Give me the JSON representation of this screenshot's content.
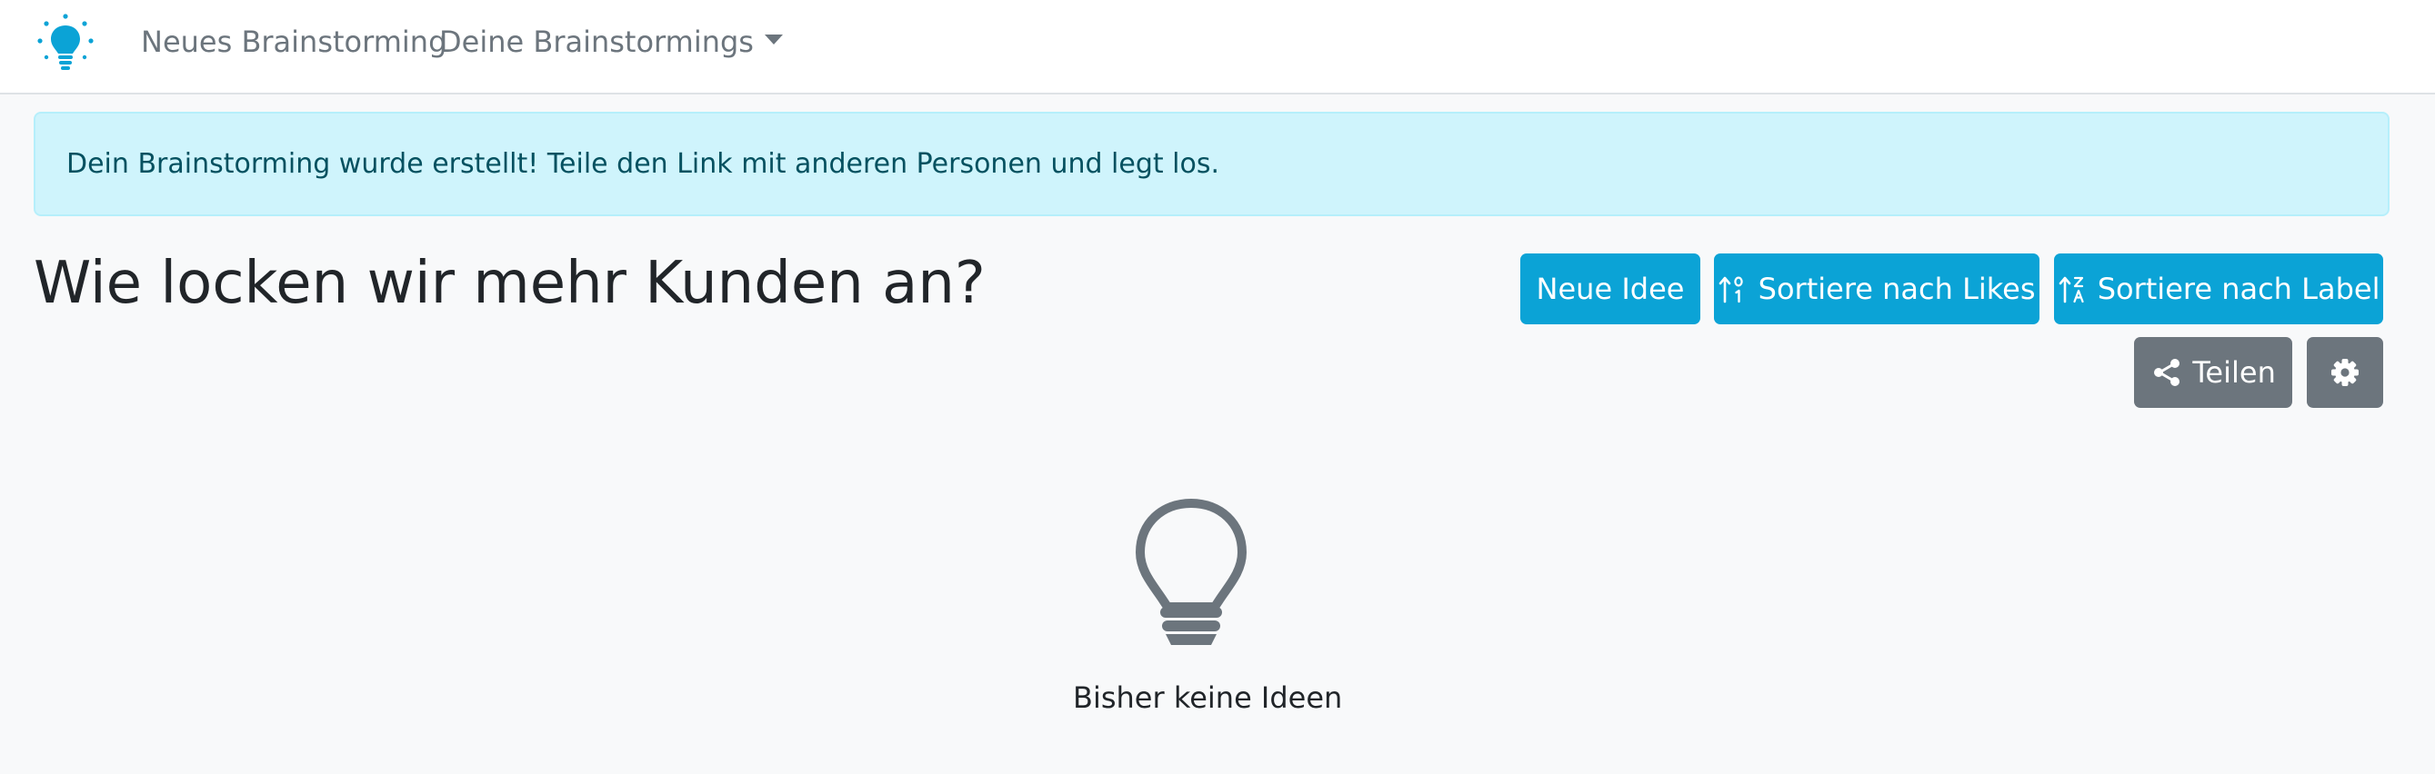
{
  "navbar": {
    "brand_icon": "lightbulb-icon",
    "links": [
      {
        "label": "Neues Brainstorming"
      },
      {
        "label": "Deine Brainstormings",
        "dropdown": true
      }
    ]
  },
  "alert": {
    "message": "Dein Brainstorming wurde erstellt! Teile den Link mit anderen Personen und legt los."
  },
  "page": {
    "title": "Wie locken wir mehr Kunden an?"
  },
  "toolbar": {
    "new_idea_label": "Neue Idee",
    "sort_likes_label": "Sortiere nach Likes",
    "sort_label_label": "Sortiere nach Label",
    "share_label": "Teilen",
    "settings_icon": "gear-icon"
  },
  "empty_state": {
    "icon": "lightbulb-outline-icon",
    "text": "Bisher keine Ideen"
  },
  "colors": {
    "accent": "#0ba3d6",
    "secondary": "#6c757d",
    "alert_bg": "#cff4fc",
    "alert_text": "#055160",
    "page_bg": "#f8f9fa"
  }
}
